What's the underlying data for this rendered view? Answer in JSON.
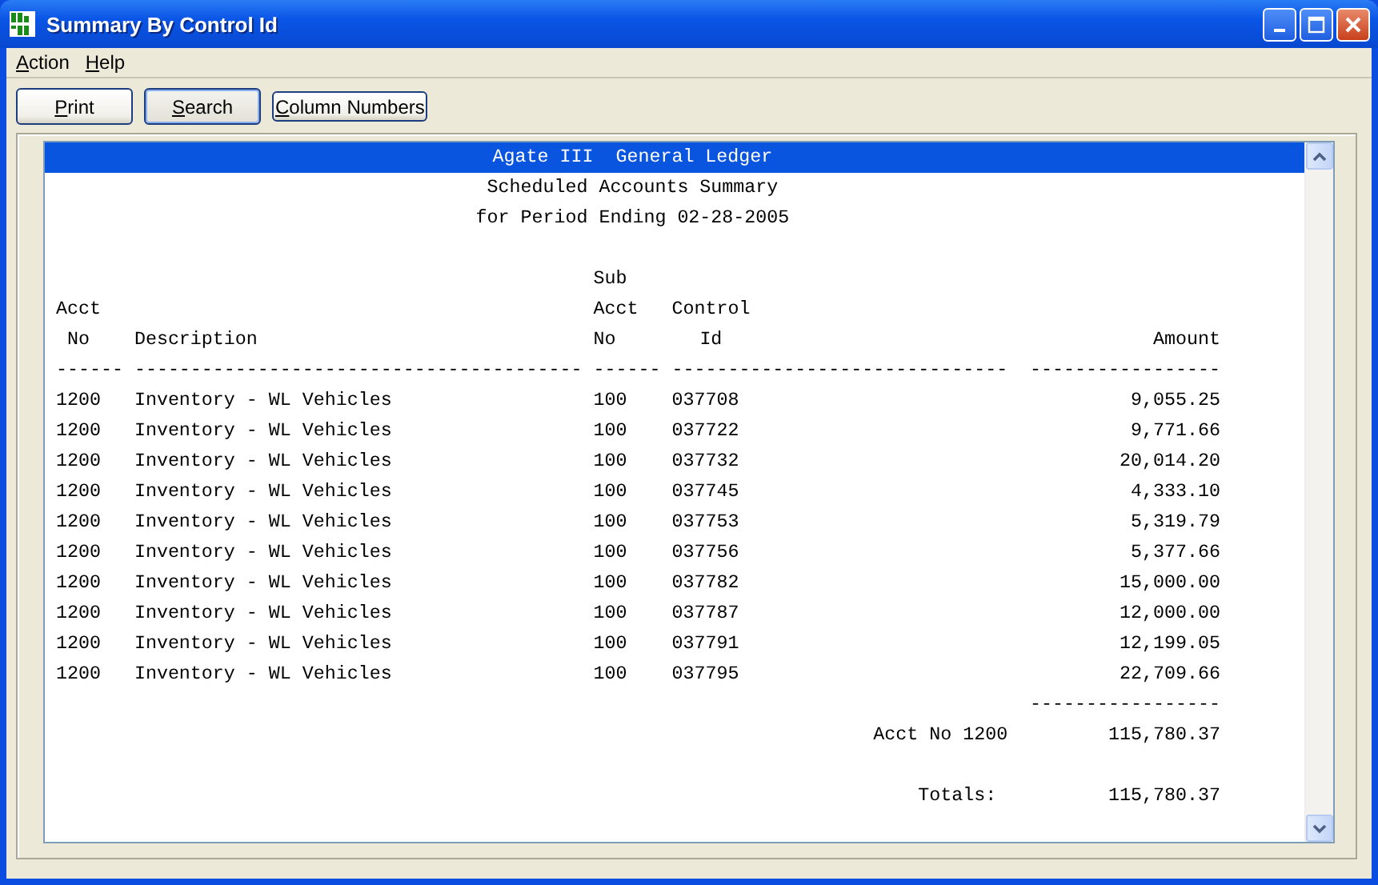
{
  "window": {
    "title": "Summary By Control Id"
  },
  "menu": [
    {
      "label": "Action"
    },
    {
      "label": "Help"
    }
  ],
  "toolbar": [
    {
      "label": "Print",
      "focused": false
    },
    {
      "label": "Search",
      "focused": true
    },
    {
      "label": "Column Numbers",
      "focused": false
    }
  ],
  "report": {
    "heading": [
      {
        "text": "Agate III  General Ledger",
        "selected": true
      },
      {
        "text": "Scheduled Accounts Summary",
        "selected": false
      },
      {
        "text": "for Period Ending 02-28-2005",
        "selected": false
      }
    ],
    "column_headers": [
      {
        "lines": [
          "Acct",
          "No"
        ]
      },
      {
        "lines": [
          "Description"
        ]
      },
      {
        "lines": [
          "Sub",
          "Acct",
          "No"
        ]
      },
      {
        "lines": [
          "Control",
          "Id"
        ]
      },
      {
        "lines": [
          "Amount"
        ]
      }
    ],
    "separators": [
      "------",
      "----------------------------------------",
      "------",
      "------------------------------",
      "-----------------"
    ],
    "rows": [
      [
        "1200",
        "Inventory - WL Vehicles",
        "100",
        "037708",
        "9,055.25"
      ],
      [
        "1200",
        "Inventory - WL Vehicles",
        "100",
        "037722",
        "9,771.66"
      ],
      [
        "1200",
        "Inventory - WL Vehicles",
        "100",
        "037732",
        "20,014.20"
      ],
      [
        "1200",
        "Inventory - WL Vehicles",
        "100",
        "037745",
        "4,333.10"
      ],
      [
        "1200",
        "Inventory - WL Vehicles",
        "100",
        "037753",
        "5,319.79"
      ],
      [
        "1200",
        "Inventory - WL Vehicles",
        "100",
        "037756",
        "5,377.66"
      ],
      [
        "1200",
        "Inventory - WL Vehicles",
        "100",
        "037782",
        "15,000.00"
      ],
      [
        "1200",
        "Inventory - WL Vehicles",
        "100",
        "037787",
        "12,000.00"
      ],
      [
        "1200",
        "Inventory - WL Vehicles",
        "100",
        "037791",
        "12,199.05"
      ],
      [
        "1200",
        "Inventory - WL Vehicles",
        "100",
        "037795",
        "22,709.66"
      ]
    ],
    "subtotal_rule": "-----------------",
    "subtotal": {
      "label": "Acct No 1200",
      "amount": "115,780.37"
    },
    "totals": {
      "label": "Totals:",
      "amount": "115,780.37"
    }
  }
}
